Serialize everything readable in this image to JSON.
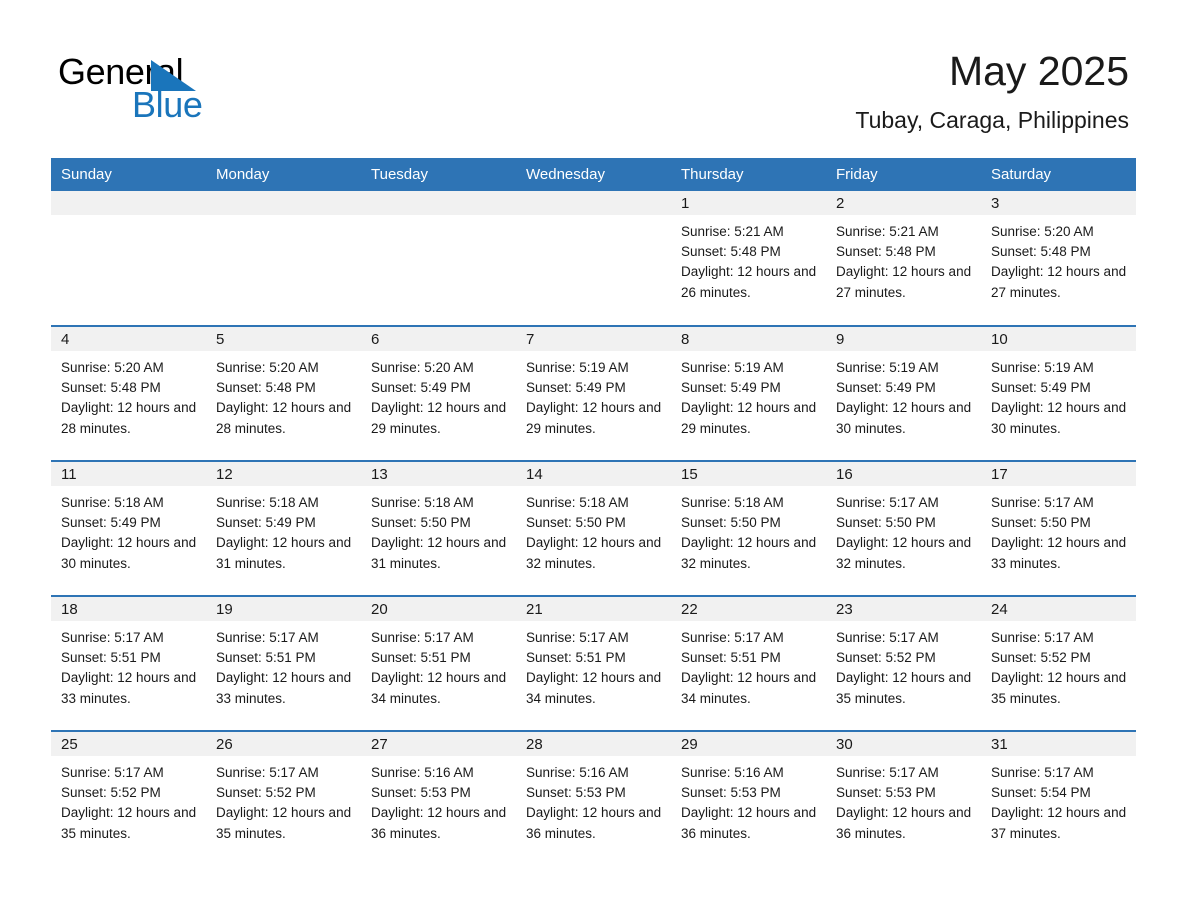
{
  "logo": {
    "word_one": "General",
    "word_two": "Blue",
    "triangle_color": "#1a75bb",
    "text_color": "#000000"
  },
  "header": {
    "month_title": "May 2025",
    "location": "Tubay, Caraga, Philippines"
  },
  "theme": {
    "header_blue": "#2e74b5",
    "band_gray": "#f1f1f1",
    "text_dark": "#1a1a1a"
  },
  "weekday_headers": [
    "Sunday",
    "Monday",
    "Tuesday",
    "Wednesday",
    "Thursday",
    "Friday",
    "Saturday"
  ],
  "weeks": [
    [
      {
        "day": "",
        "sunrise": "",
        "sunset": "",
        "daylight": ""
      },
      {
        "day": "",
        "sunrise": "",
        "sunset": "",
        "daylight": ""
      },
      {
        "day": "",
        "sunrise": "",
        "sunset": "",
        "daylight": ""
      },
      {
        "day": "",
        "sunrise": "",
        "sunset": "",
        "daylight": ""
      },
      {
        "day": "1",
        "sunrise": "Sunrise: 5:21 AM",
        "sunset": "Sunset: 5:48 PM",
        "daylight": "Daylight: 12 hours and 26 minutes."
      },
      {
        "day": "2",
        "sunrise": "Sunrise: 5:21 AM",
        "sunset": "Sunset: 5:48 PM",
        "daylight": "Daylight: 12 hours and 27 minutes."
      },
      {
        "day": "3",
        "sunrise": "Sunrise: 5:20 AM",
        "sunset": "Sunset: 5:48 PM",
        "daylight": "Daylight: 12 hours and 27 minutes."
      }
    ],
    [
      {
        "day": "4",
        "sunrise": "Sunrise: 5:20 AM",
        "sunset": "Sunset: 5:48 PM",
        "daylight": "Daylight: 12 hours and 28 minutes."
      },
      {
        "day": "5",
        "sunrise": "Sunrise: 5:20 AM",
        "sunset": "Sunset: 5:48 PM",
        "daylight": "Daylight: 12 hours and 28 minutes."
      },
      {
        "day": "6",
        "sunrise": "Sunrise: 5:20 AM",
        "sunset": "Sunset: 5:49 PM",
        "daylight": "Daylight: 12 hours and 29 minutes."
      },
      {
        "day": "7",
        "sunrise": "Sunrise: 5:19 AM",
        "sunset": "Sunset: 5:49 PM",
        "daylight": "Daylight: 12 hours and 29 minutes."
      },
      {
        "day": "8",
        "sunrise": "Sunrise: 5:19 AM",
        "sunset": "Sunset: 5:49 PM",
        "daylight": "Daylight: 12 hours and 29 minutes."
      },
      {
        "day": "9",
        "sunrise": "Sunrise: 5:19 AM",
        "sunset": "Sunset: 5:49 PM",
        "daylight": "Daylight: 12 hours and 30 minutes."
      },
      {
        "day": "10",
        "sunrise": "Sunrise: 5:19 AM",
        "sunset": "Sunset: 5:49 PM",
        "daylight": "Daylight: 12 hours and 30 minutes."
      }
    ],
    [
      {
        "day": "11",
        "sunrise": "Sunrise: 5:18 AM",
        "sunset": "Sunset: 5:49 PM",
        "daylight": "Daylight: 12 hours and 30 minutes."
      },
      {
        "day": "12",
        "sunrise": "Sunrise: 5:18 AM",
        "sunset": "Sunset: 5:49 PM",
        "daylight": "Daylight: 12 hours and 31 minutes."
      },
      {
        "day": "13",
        "sunrise": "Sunrise: 5:18 AM",
        "sunset": "Sunset: 5:50 PM",
        "daylight": "Daylight: 12 hours and 31 minutes."
      },
      {
        "day": "14",
        "sunrise": "Sunrise: 5:18 AM",
        "sunset": "Sunset: 5:50 PM",
        "daylight": "Daylight: 12 hours and 32 minutes."
      },
      {
        "day": "15",
        "sunrise": "Sunrise: 5:18 AM",
        "sunset": "Sunset: 5:50 PM",
        "daylight": "Daylight: 12 hours and 32 minutes."
      },
      {
        "day": "16",
        "sunrise": "Sunrise: 5:17 AM",
        "sunset": "Sunset: 5:50 PM",
        "daylight": "Daylight: 12 hours and 32 minutes."
      },
      {
        "day": "17",
        "sunrise": "Sunrise: 5:17 AM",
        "sunset": "Sunset: 5:50 PM",
        "daylight": "Daylight: 12 hours and 33 minutes."
      }
    ],
    [
      {
        "day": "18",
        "sunrise": "Sunrise: 5:17 AM",
        "sunset": "Sunset: 5:51 PM",
        "daylight": "Daylight: 12 hours and 33 minutes."
      },
      {
        "day": "19",
        "sunrise": "Sunrise: 5:17 AM",
        "sunset": "Sunset: 5:51 PM",
        "daylight": "Daylight: 12 hours and 33 minutes."
      },
      {
        "day": "20",
        "sunrise": "Sunrise: 5:17 AM",
        "sunset": "Sunset: 5:51 PM",
        "daylight": "Daylight: 12 hours and 34 minutes."
      },
      {
        "day": "21",
        "sunrise": "Sunrise: 5:17 AM",
        "sunset": "Sunset: 5:51 PM",
        "daylight": "Daylight: 12 hours and 34 minutes."
      },
      {
        "day": "22",
        "sunrise": "Sunrise: 5:17 AM",
        "sunset": "Sunset: 5:51 PM",
        "daylight": "Daylight: 12 hours and 34 minutes."
      },
      {
        "day": "23",
        "sunrise": "Sunrise: 5:17 AM",
        "sunset": "Sunset: 5:52 PM",
        "daylight": "Daylight: 12 hours and 35 minutes."
      },
      {
        "day": "24",
        "sunrise": "Sunrise: 5:17 AM",
        "sunset": "Sunset: 5:52 PM",
        "daylight": "Daylight: 12 hours and 35 minutes."
      }
    ],
    [
      {
        "day": "25",
        "sunrise": "Sunrise: 5:17 AM",
        "sunset": "Sunset: 5:52 PM",
        "daylight": "Daylight: 12 hours and 35 minutes."
      },
      {
        "day": "26",
        "sunrise": "Sunrise: 5:17 AM",
        "sunset": "Sunset: 5:52 PM",
        "daylight": "Daylight: 12 hours and 35 minutes."
      },
      {
        "day": "27",
        "sunrise": "Sunrise: 5:16 AM",
        "sunset": "Sunset: 5:53 PM",
        "daylight": "Daylight: 12 hours and 36 minutes."
      },
      {
        "day": "28",
        "sunrise": "Sunrise: 5:16 AM",
        "sunset": "Sunset: 5:53 PM",
        "daylight": "Daylight: 12 hours and 36 minutes."
      },
      {
        "day": "29",
        "sunrise": "Sunrise: 5:16 AM",
        "sunset": "Sunset: 5:53 PM",
        "daylight": "Daylight: 12 hours and 36 minutes."
      },
      {
        "day": "30",
        "sunrise": "Sunrise: 5:17 AM",
        "sunset": "Sunset: 5:53 PM",
        "daylight": "Daylight: 12 hours and 36 minutes."
      },
      {
        "day": "31",
        "sunrise": "Sunrise: 5:17 AM",
        "sunset": "Sunset: 5:54 PM",
        "daylight": "Daylight: 12 hours and 37 minutes."
      }
    ]
  ]
}
